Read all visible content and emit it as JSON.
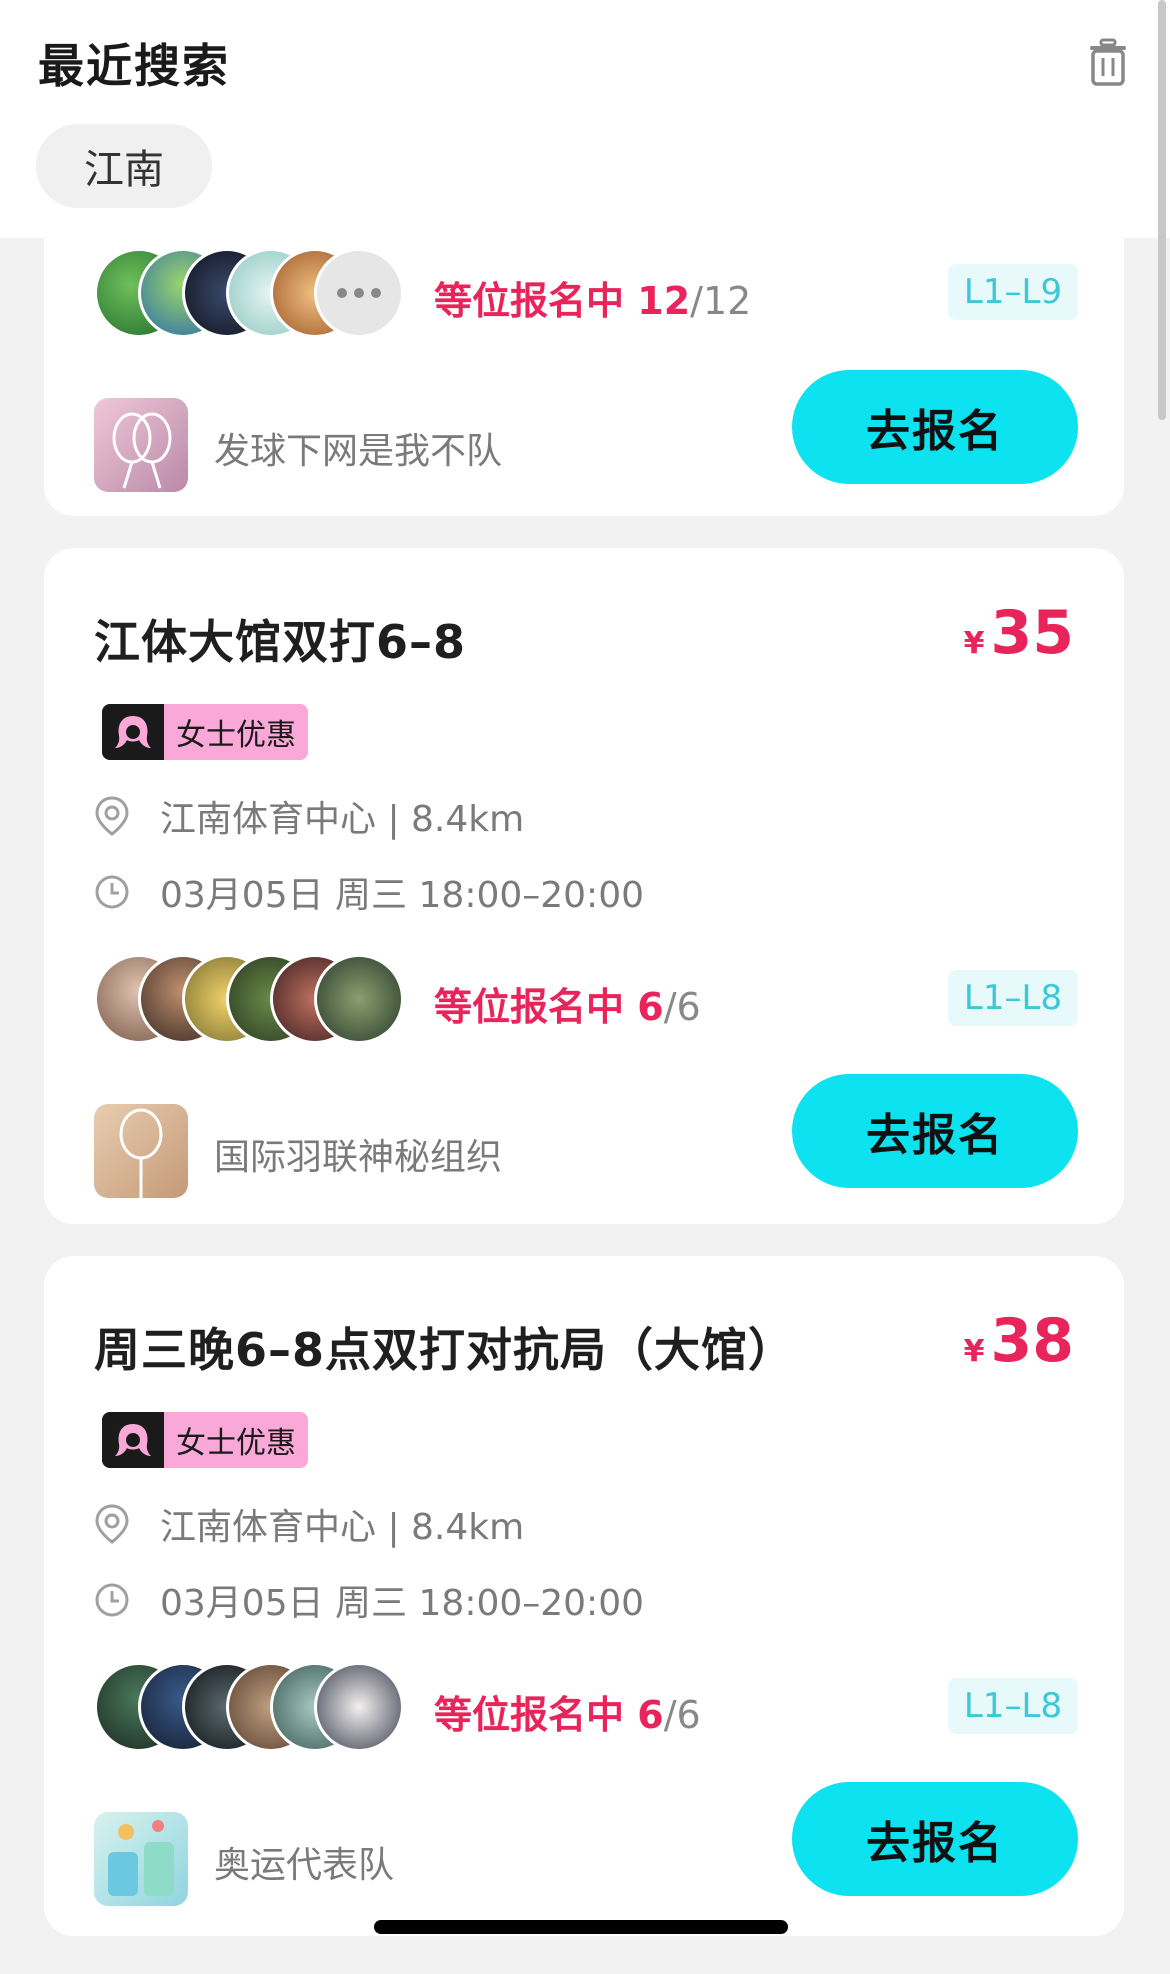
{
  "recent_search": {
    "title": "最近搜索",
    "chips": [
      "江南"
    ]
  },
  "cards": [
    {
      "status_label": "等位报名中",
      "status_count": "12",
      "status_total": "/12",
      "level": "L1–L9",
      "organizer": "发球下网是我不队",
      "join_label": "去报名",
      "more_icon": "ellipsis-icon"
    },
    {
      "title": "江体大馆双打6–8",
      "currency": "¥",
      "price": "35",
      "badge": "女士优惠",
      "location": "江南体育中心 | 8.4km",
      "time": "03月05日 周三 18:00–20:00",
      "status_label": "等位报名中",
      "status_count": "6",
      "status_total": "/6",
      "level": "L1–L8",
      "organizer": "国际羽联神秘组织",
      "join_label": "去报名"
    },
    {
      "title": "周三晚6–8点双打对抗局（大馆）",
      "currency": "¥",
      "price": "38",
      "badge": "女士优惠",
      "location": "江南体育中心 | 8.4km",
      "time": "03月05日 周三 18:00–20:00",
      "status_label": "等位报名中",
      "status_count": "6",
      "status_total": "/6",
      "level": "L1–L8",
      "organizer": "奥运代表队",
      "join_label": "去报名"
    }
  ],
  "colors": {
    "accent_button": "#0de3f0",
    "price_red": "#e8245a",
    "badge_pink": "#f9a8d8",
    "level_teal": "#3cc8d8"
  }
}
